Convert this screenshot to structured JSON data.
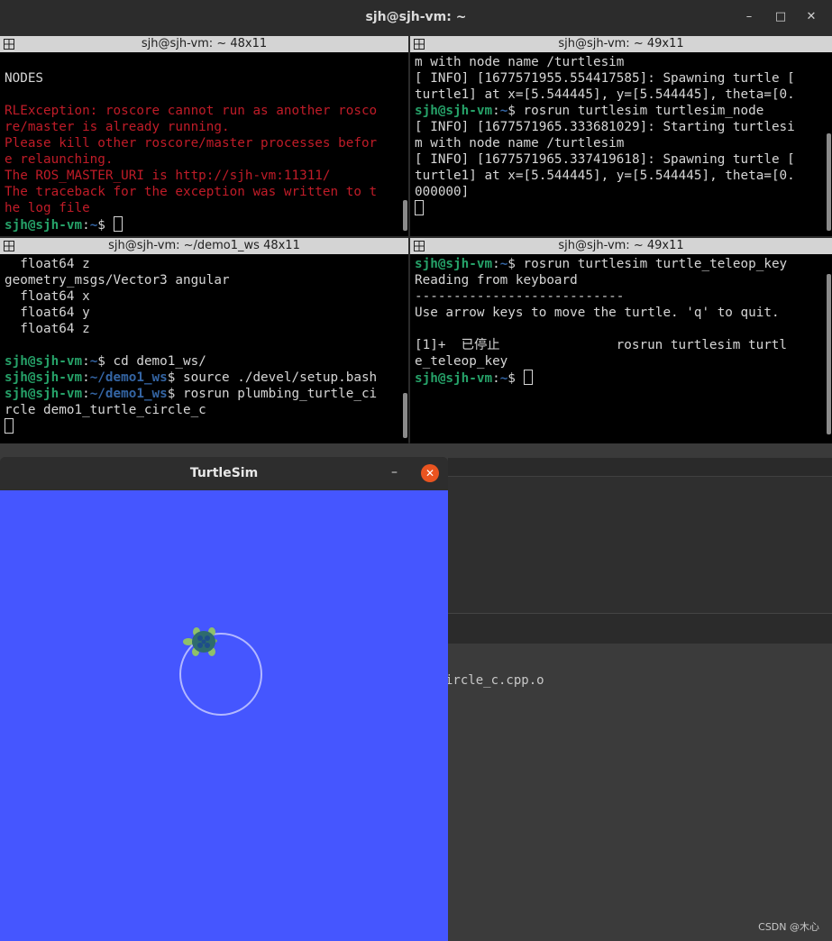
{
  "terminal_window": {
    "title": "sjh@sjh-vm: ~"
  },
  "panes": {
    "top_left": {
      "header": "sjh@sjh-vm: ~ 48x11",
      "lines": [
        [
          {
            "t": "",
            "c": "w"
          }
        ],
        [
          {
            "t": "NODES",
            "c": "w"
          }
        ],
        [
          {
            "t": "",
            "c": "w"
          }
        ],
        [
          {
            "t": "RLException: roscore cannot run as another rosco",
            "c": "red"
          }
        ],
        [
          {
            "t": "re/master is already running.",
            "c": "red"
          }
        ],
        [
          {
            "t": "Please kill other roscore/master processes befor",
            "c": "red"
          }
        ],
        [
          {
            "t": "e relaunching.",
            "c": "red"
          }
        ],
        [
          {
            "t": "The ROS_MASTER_URI is http://sjh-vm:11311/",
            "c": "red"
          }
        ],
        [
          {
            "t": "The traceback for the exception was written to t",
            "c": "red"
          }
        ],
        [
          {
            "t": "he log file",
            "c": "red"
          }
        ],
        [
          {
            "t": "sjh@sjh-vm",
            "c": "g"
          },
          {
            "t": ":",
            "c": "w"
          },
          {
            "t": "~",
            "c": "b"
          },
          {
            "t": "$ ",
            "c": "w"
          },
          {
            "cursor": true
          }
        ]
      ]
    },
    "top_right": {
      "header": "sjh@sjh-vm: ~ 49x11",
      "lines": [
        [
          {
            "t": "m with node name /turtlesim",
            "c": "w"
          }
        ],
        [
          {
            "t": "[ INFO] [1677571955.554417585]: Spawning turtle [",
            "c": "w"
          }
        ],
        [
          {
            "t": "turtle1] at x=[5.544445], y=[5.544445], theta=[0.",
            "c": "w"
          }
        ],
        [
          {
            "t": "sjh@sjh-vm",
            "c": "g"
          },
          {
            "t": ":",
            "c": "w"
          },
          {
            "t": "~",
            "c": "b"
          },
          {
            "t": "$ rosrun turtlesim turtlesim_node",
            "c": "w"
          }
        ],
        [
          {
            "t": "[ INFO] [1677571965.333681029]: Starting turtlesi",
            "c": "w"
          }
        ],
        [
          {
            "t": "m with node name /turtlesim",
            "c": "w"
          }
        ],
        [
          {
            "t": "[ INFO] [1677571965.337419618]: Spawning turtle [",
            "c": "w"
          }
        ],
        [
          {
            "t": "turtle1] at x=[5.544445], y=[5.544445], theta=[0.",
            "c": "w"
          }
        ],
        [
          {
            "t": "000000]",
            "c": "w"
          }
        ],
        [
          {
            "cursor": true
          }
        ]
      ]
    },
    "bottom_left": {
      "header": "sjh@sjh-vm: ~/demo1_ws 48x11",
      "lines": [
        [
          {
            "t": "  float64 z",
            "c": "w"
          }
        ],
        [
          {
            "t": "geometry_msgs/Vector3 angular",
            "c": "w"
          }
        ],
        [
          {
            "t": "  float64 x",
            "c": "w"
          }
        ],
        [
          {
            "t": "  float64 y",
            "c": "w"
          }
        ],
        [
          {
            "t": "  float64 z",
            "c": "w"
          }
        ],
        [
          {
            "t": "",
            "c": "w"
          }
        ],
        [
          {
            "t": "sjh@sjh-vm",
            "c": "g"
          },
          {
            "t": ":",
            "c": "w"
          },
          {
            "t": "~",
            "c": "b"
          },
          {
            "t": "$ cd demo1_ws/",
            "c": "w"
          }
        ],
        [
          {
            "t": "sjh@sjh-vm",
            "c": "g"
          },
          {
            "t": ":",
            "c": "w"
          },
          {
            "t": "~/demo1_ws",
            "c": "b"
          },
          {
            "t": "$ source ./devel/setup.bash",
            "c": "w"
          }
        ],
        [
          {
            "t": "sjh@sjh-vm",
            "c": "g"
          },
          {
            "t": ":",
            "c": "w"
          },
          {
            "t": "~/demo1_ws",
            "c": "b"
          },
          {
            "t": "$ rosrun plumbing_turtle_ci",
            "c": "w"
          }
        ],
        [
          {
            "t": "rcle demo1_turtle_circle_c",
            "c": "w"
          }
        ],
        [
          {
            "cursor": true
          }
        ]
      ]
    },
    "bottom_right": {
      "header": "sjh@sjh-vm: ~ 49x11",
      "lines": [
        [
          {
            "t": "sjh@sjh-vm",
            "c": "g"
          },
          {
            "t": ":",
            "c": "w"
          },
          {
            "t": "~",
            "c": "b"
          },
          {
            "t": "$ rosrun turtlesim turtle_teleop_key",
            "c": "w"
          }
        ],
        [
          {
            "t": "Reading from keyboard",
            "c": "w"
          }
        ],
        [
          {
            "t": "---------------------------",
            "c": "w"
          }
        ],
        [
          {
            "t": "Use arrow keys to move the turtle. 'q' to quit.",
            "c": "w"
          }
        ],
        [
          {
            "t": "",
            "c": "w"
          }
        ],
        [
          {
            "t": "[1]+  已停止               rosrun turtlesim turtl",
            "c": "w"
          }
        ],
        [
          {
            "t": "e_teleop_key",
            "c": "w"
          }
        ],
        [
          {
            "t": "sjh@sjh-vm",
            "c": "g"
          },
          {
            "t": ":",
            "c": "w"
          },
          {
            "t": "~",
            "c": "b"
          },
          {
            "t": "$ ",
            "c": "w"
          },
          {
            "cursor": true
          }
        ]
      ]
    }
  },
  "turtlesim": {
    "title": "TurtleSim",
    "background": "#4556ff",
    "trail_color": "#b3b8ff"
  },
  "background": {
    "editor_text": "ircle_c.cpp.o",
    "watermark": "CSDN @木心"
  },
  "icons": {
    "minimize": "minimize-icon",
    "maximize": "maximize-icon",
    "close": "close-icon",
    "pane_grid": "grid-icon"
  }
}
